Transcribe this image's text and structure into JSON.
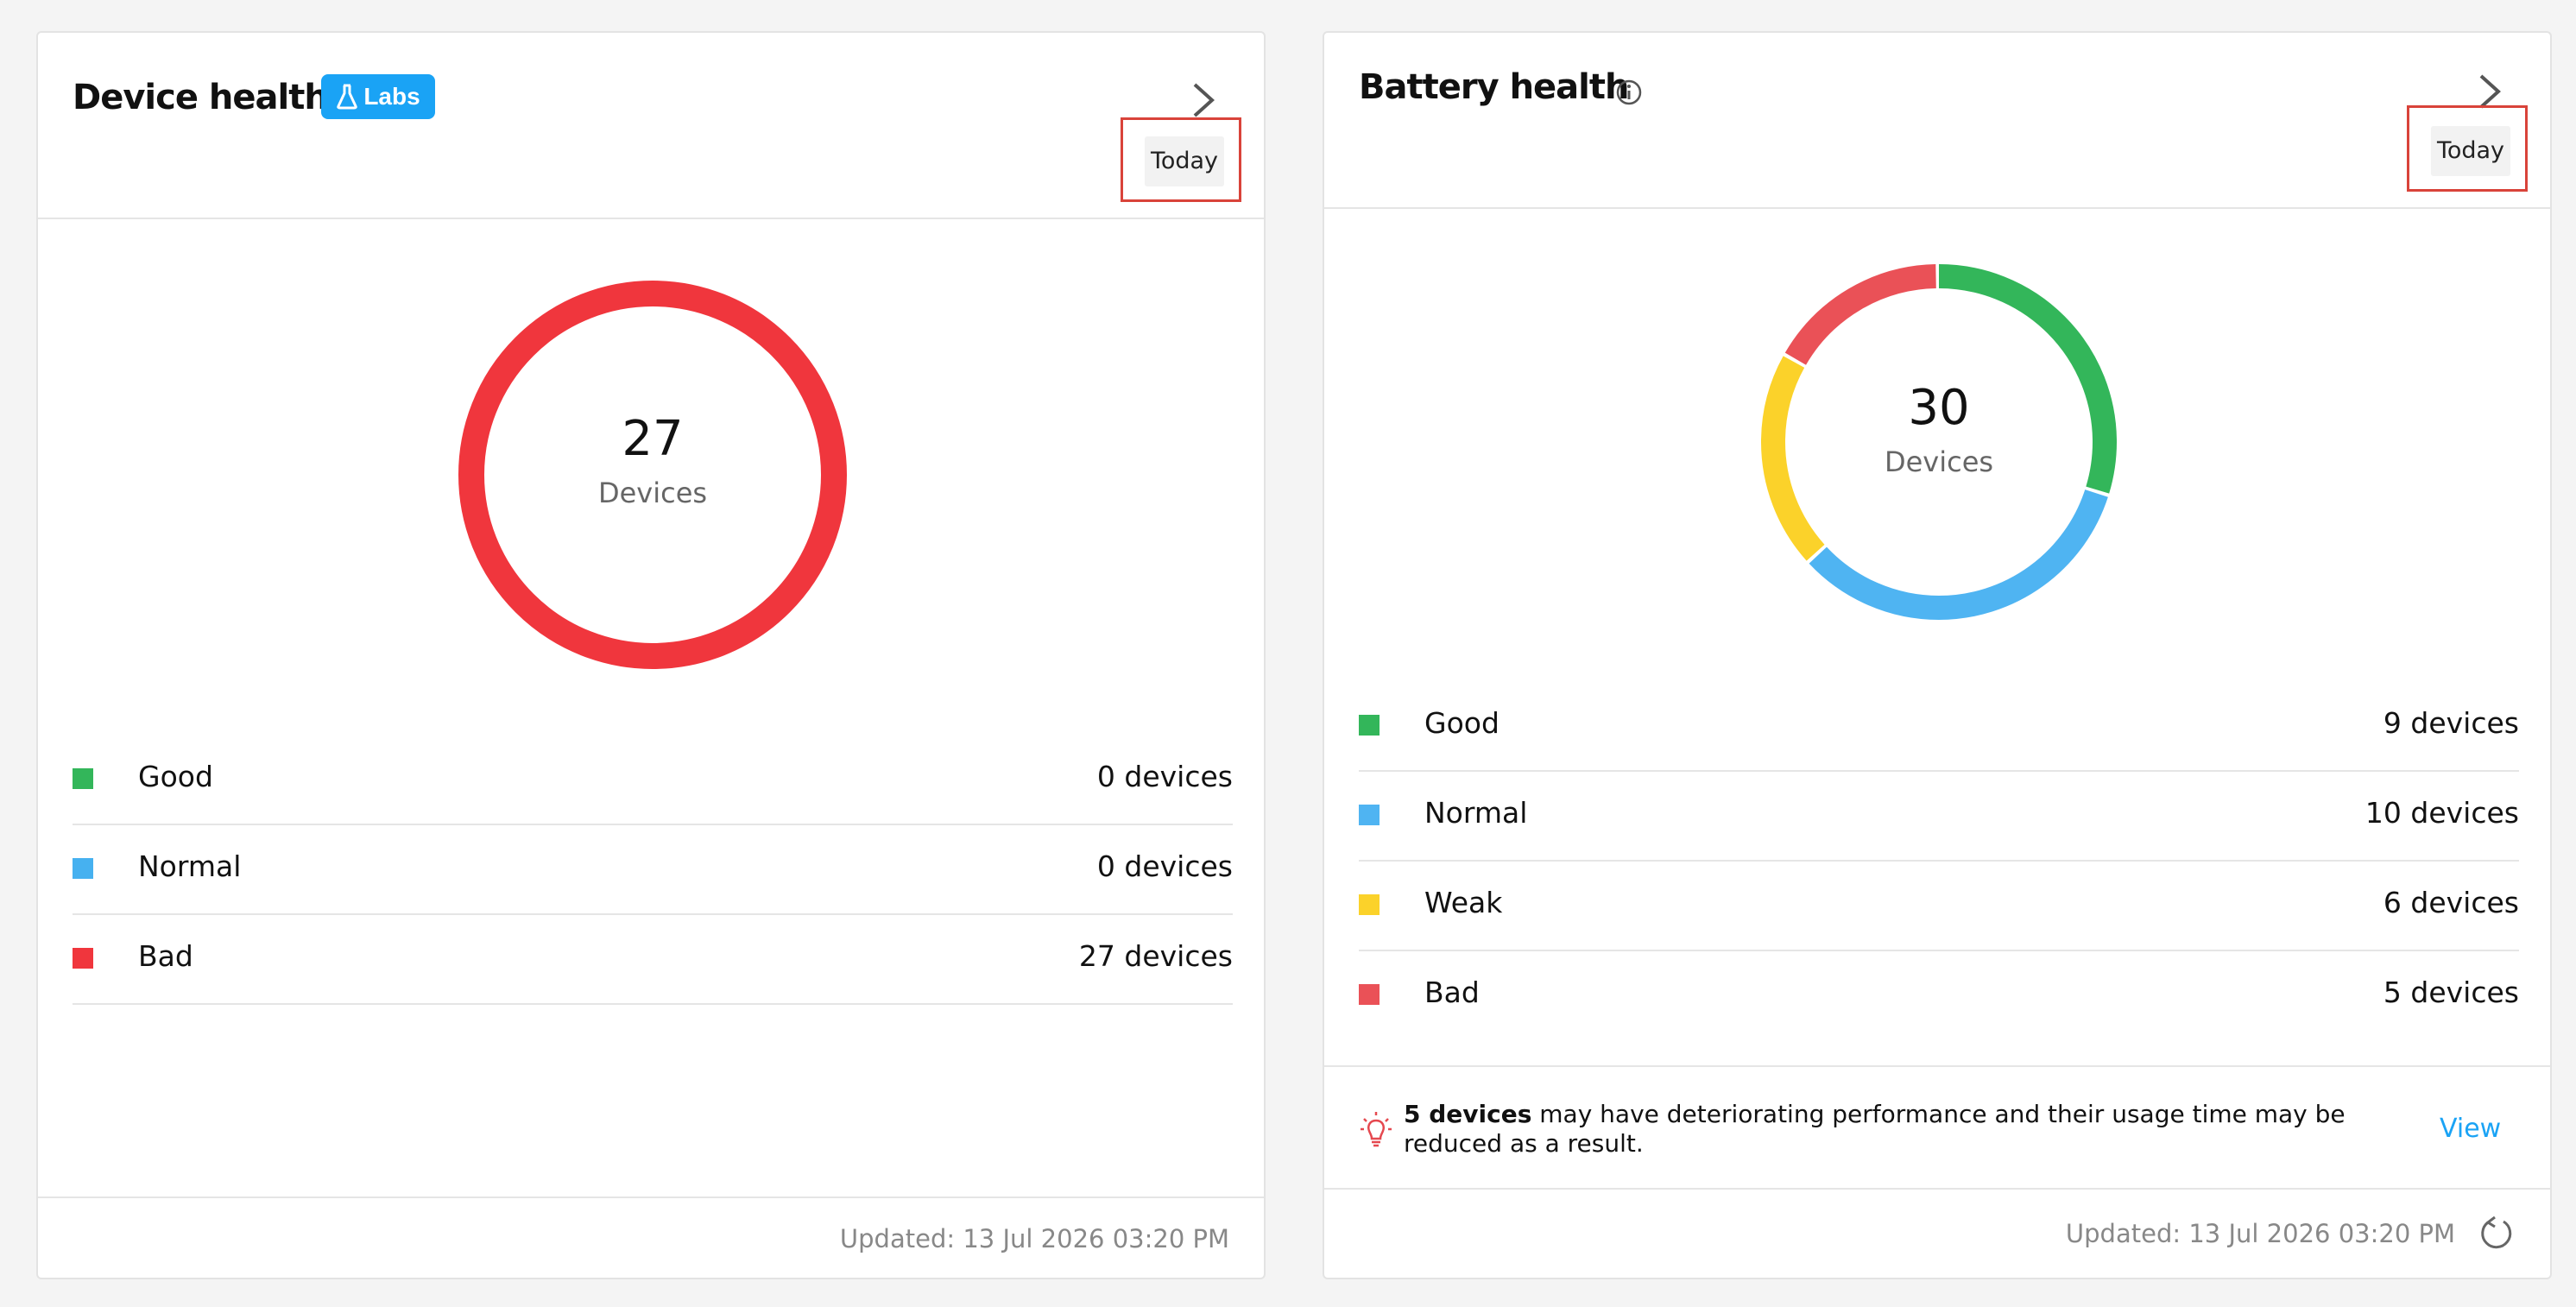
{
  "device_health": {
    "title": "Device health",
    "badge": "Labs",
    "period_button": "Today",
    "total": "27",
    "total_label": "Devices",
    "legend": [
      {
        "label": "Good",
        "value": "0 devices",
        "count": 0,
        "color": "#33b65a"
      },
      {
        "label": "Normal",
        "value": "0 devices",
        "count": 0,
        "color": "#46b1f0"
      },
      {
        "label": "Bad",
        "value": "27 devices",
        "count": 27,
        "color": "#f0363d"
      }
    ],
    "updated": "Updated: 13 Jul 2026 03:20 PM"
  },
  "battery_health": {
    "title": "Battery health",
    "period_button": "Today",
    "total": "30",
    "total_label": "Devices",
    "legend": [
      {
        "label": "Good",
        "value": "9 devices",
        "count": 9,
        "color": "#33b65a"
      },
      {
        "label": "Normal",
        "value": "10 devices",
        "count": 10,
        "color": "#4fb4f2"
      },
      {
        "label": "Weak",
        "value": "6 devices",
        "count": 6,
        "color": "#fbd22a"
      },
      {
        "label": "Bad",
        "value": "5 devices",
        "count": 5,
        "color": "#ea5157"
      }
    ],
    "notice_bold": "5 devices",
    "notice_text": " may have deteriorating performance and their usage time may be reduced as a result.",
    "view_link": "View",
    "updated": "Updated: 13 Jul 2026 03:20 PM"
  },
  "colors": {
    "accent": "#1aa3f5",
    "highlight": "#d9433a"
  },
  "icons": {
    "badge": "flask-icon",
    "info": "info-icon",
    "next": "chevron-right-icon",
    "notice": "lightbulb-icon",
    "refresh": "refresh-icon"
  }
}
